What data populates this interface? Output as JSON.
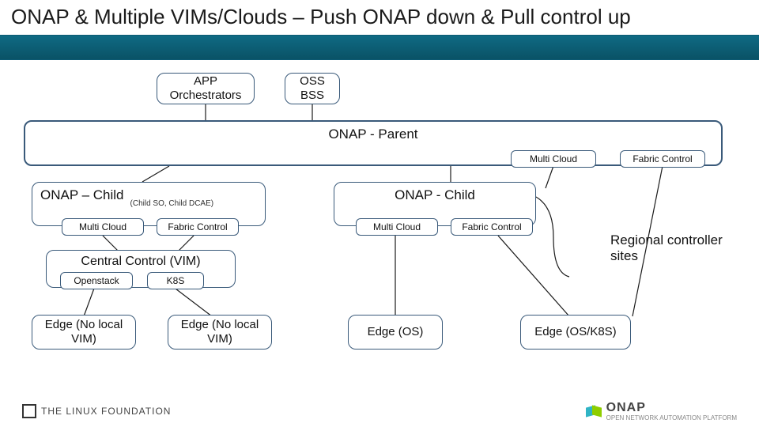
{
  "title": "ONAP & Multiple VIMs/Clouds – Push ONAP down & Pull control up",
  "top": {
    "app_orch": "APP\nOrchestrators",
    "oss_bss": "OSS\nBSS"
  },
  "parent": {
    "label": "ONAP - Parent",
    "mc": "Multi  Cloud",
    "fc": "Fabric Control"
  },
  "child_left": {
    "label": "ONAP – Child",
    "sub": "(Child SO, Child DCAE)",
    "mc": "Multi  Cloud",
    "fc": "Fabric Control"
  },
  "child_right": {
    "label": "ONAP - Child",
    "mc": "Multi  Cloud",
    "fc": "Fabric Control"
  },
  "central": {
    "label": "Central Control (VIM)",
    "os": "Openstack",
    "k8s": "K8S"
  },
  "edges": {
    "e1": "Edge (No local\nVIM)",
    "e2": "Edge (No local\nVIM)",
    "e3": "Edge (OS)",
    "e4": "Edge (OS/K8S)"
  },
  "note": "Regional controller\nsites",
  "footer": {
    "lf": "THE LINUX FOUNDATION",
    "onap": "ONAP",
    "onap_tag": "OPEN NETWORK AUTOMATION PLATFORM"
  }
}
